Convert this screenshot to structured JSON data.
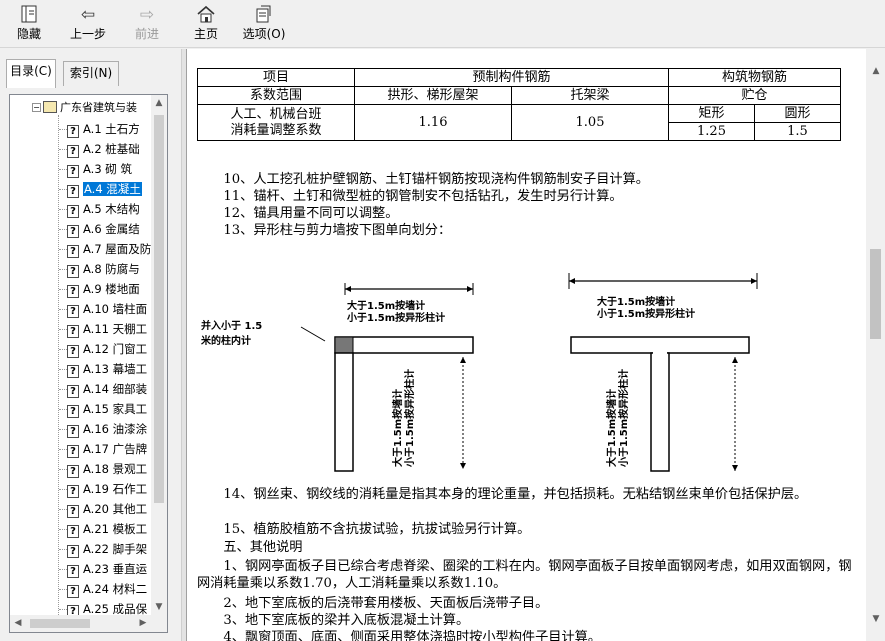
{
  "toolbar": {
    "hide": "隐藏",
    "back": "上一步",
    "forward": "前进",
    "home": "主页",
    "options": "选项(O)"
  },
  "nav": {
    "tab_contents": "目录(C)",
    "tab_index": "索引(N)",
    "root": "广东省建筑与装",
    "items": [
      {
        "label": "A.1  土石方"
      },
      {
        "label": "A.2  桩基础"
      },
      {
        "label": "A.3  砌  筑"
      },
      {
        "label": "A.4  混凝土"
      },
      {
        "label": "A.5  木结构"
      },
      {
        "label": "A.6  金属结"
      },
      {
        "label": "A.7 屋面及防"
      },
      {
        "label": "A.8  防腐与"
      },
      {
        "label": "A.9  楼地面"
      },
      {
        "label": "A.10  墙柱面"
      },
      {
        "label": "A.11  天棚工"
      },
      {
        "label": "A.12  门窗工"
      },
      {
        "label": "A.13  幕墙工"
      },
      {
        "label": "A.14  细部装"
      },
      {
        "label": "A.15  家具工"
      },
      {
        "label": "A.16  油漆涂"
      },
      {
        "label": "A.17  广告牌"
      },
      {
        "label": "A.18 景观工"
      },
      {
        "label": "A.19 石作工"
      },
      {
        "label": "A.20  其他工"
      },
      {
        "label": "A.21  模板工"
      },
      {
        "label": "A.22  脚手架"
      },
      {
        "label": "A.23  垂直运"
      },
      {
        "label": "A.24  材料二"
      },
      {
        "label": "A.25  成品保"
      }
    ]
  },
  "table": {
    "h_item": "项目",
    "h_prefab": "预制构件钢筋",
    "h_struct": "构筑物钢筋",
    "r2_label": "系数范围",
    "r2_arch": "拱形、梯形屋架",
    "r2_truss": "托架梁",
    "r2_silo": "贮仓",
    "r3_label_1": "人工、机械台班",
    "r3_label_2": "消耗量调整系数",
    "r3_rect": "矩形",
    "r3_round": "圆形",
    "v_arch": "1.16",
    "v_truss": "1.05",
    "v_rect": "1.25",
    "v_round": "1.5"
  },
  "text": {
    "p10": "　　10、人工挖孔桩护壁钢筋、土钉锚杆钢筋按现浇构件钢筋制安子目计算。",
    "p11": "　　11、锚杆、土钉和微型桩的钢管制安不包括钻孔，发生时另行计算。",
    "p12": "　　12、锚具用量不同可以调整。",
    "p13": "　　13、异形柱与剪力墙按下图单向划分：",
    "p14": "　　14、钢丝束、钢绞线的消耗量是指其本身的理论重量，并包括损耗。无粘结钢丝束单价包括保护层。",
    "p15": "　　15、植筋胶植筋不含抗拔试验，抗拔试验另行计算。",
    "p5": "　　五、其他说明",
    "p5_1": "　　1、钢网亭面板子目已综合考虑脊梁、圈梁的工料在内。钢网亭面板子目按单面钢网考虑，如用双面钢网，钢网消耗量乘以系数1.70，人工消耗量乘以系数1.10。",
    "p5_2": "　　2、地下室底板的后浇带套用楼板、天面板后浇带子目。",
    "p5_3": "　　3、地下室底板的梁并入底板混凝土计算。",
    "p5_4": "　　4、飘窗顶面、底面、侧面采用整体浇捣时按小型构件子目计算。"
  },
  "figure": {
    "left_note_1": "并入小于 1.5",
    "left_note_2": "米的柱内计",
    "top_note_1": "大于1.5m按墙计",
    "top_note_2": "小于1.5m按异形柱计",
    "vert_note_1": "大于1.5m按墙计",
    "vert_note_2": "小于1.5m按异形柱计"
  }
}
